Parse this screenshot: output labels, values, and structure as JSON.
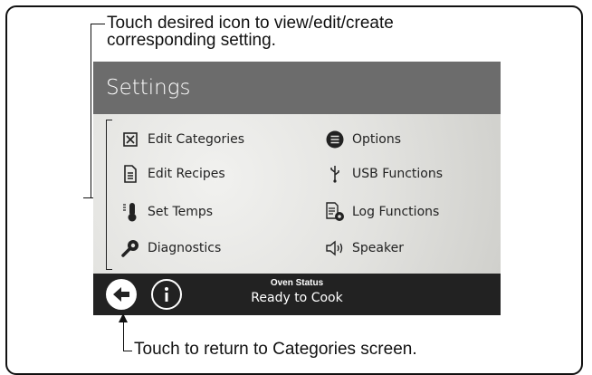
{
  "callouts": {
    "top_line1": "Touch desired icon to view/edit/create",
    "top_line2": "corresponding setting.",
    "bottom": "Touch to return to Categories screen."
  },
  "screen": {
    "title": "Settings",
    "items_left": [
      {
        "label": "Edit Categories",
        "icon": "edit-categories-icon"
      },
      {
        "label": "Edit Recipes",
        "icon": "document-icon"
      },
      {
        "label": "Set Temps",
        "icon": "thermometer-icon"
      },
      {
        "label": "Diagnostics",
        "icon": "wrench-gear-icon"
      }
    ],
    "items_right": [
      {
        "label": "Options",
        "icon": "list-icon"
      },
      {
        "label": "USB Functions",
        "icon": "usb-icon"
      },
      {
        "label": "Log Functions",
        "icon": "log-functions-icon"
      },
      {
        "label": "Speaker",
        "icon": "speaker-icon"
      }
    ],
    "footer": {
      "status_label": "Oven Status",
      "status_value": "Ready to Cook",
      "back_icon": "back-arrow-icon",
      "info_icon": "info-icon"
    }
  },
  "colors": {
    "header_bg": "#6c6c6c",
    "footer_bg": "#222222",
    "body_bg": "#e2e2df"
  }
}
